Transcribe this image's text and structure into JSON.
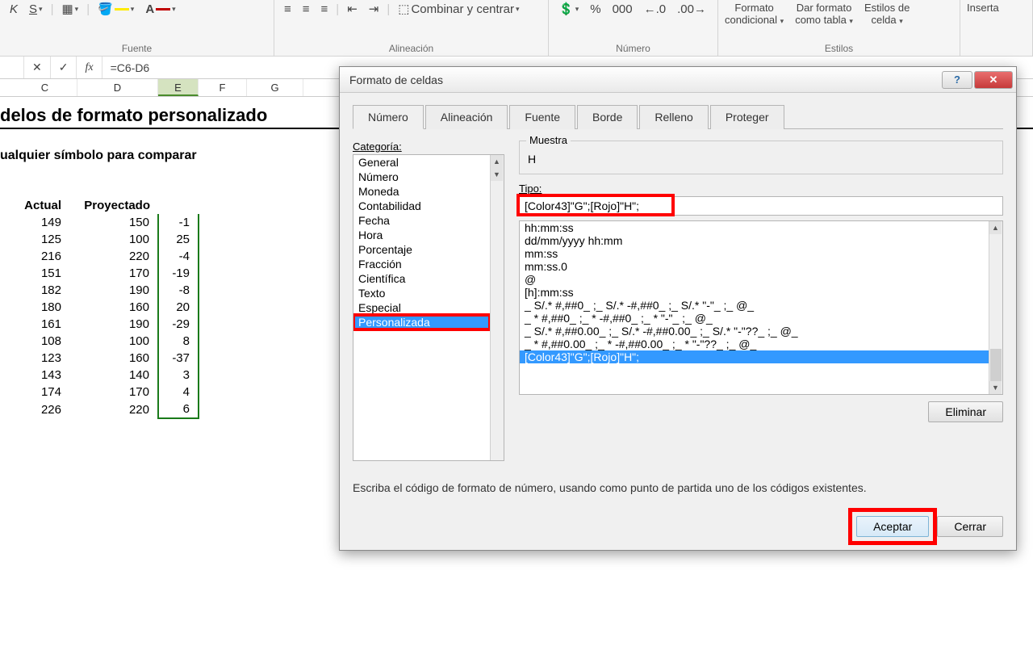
{
  "ribbon": {
    "groups": {
      "fuente": "Fuente",
      "alineacion": "Alineación",
      "numero": "Número",
      "estilos": "Estilos"
    },
    "combinar": "Combinar y centrar",
    "formato_label": "Formato",
    "condicional": "condicional",
    "dar_formato": "Dar formato",
    "como_tabla": "como tabla",
    "estilos_de": "Estilos de",
    "celda": "celda",
    "insertar": "Inserta",
    "simbolos": {
      "K": "K",
      "S": "S",
      "percent": "%",
      "mil": "000",
      "plus": ".0",
      "minus": ".00"
    }
  },
  "formula_bar": {
    "cancel": "✕",
    "enter": "✓",
    "fx": "fx",
    "value": "=C6-D6"
  },
  "columns": [
    "C",
    "D",
    "E",
    "F",
    "G"
  ],
  "sheet": {
    "title": "delos de formato personalizado",
    "subtitle": "ualquier símbolo para comparar",
    "headers": {
      "actual": "Actual",
      "proyectado": "Proyectado"
    },
    "rows": [
      {
        "a": 149,
        "p": 150,
        "d": -1
      },
      {
        "a": 125,
        "p": 100,
        "d": 25
      },
      {
        "a": 216,
        "p": 220,
        "d": -4
      },
      {
        "a": 151,
        "p": 170,
        "d": -19
      },
      {
        "a": 182,
        "p": 190,
        "d": -8
      },
      {
        "a": 180,
        "p": 160,
        "d": 20
      },
      {
        "a": 161,
        "p": 190,
        "d": -29
      },
      {
        "a": 108,
        "p": 100,
        "d": 8
      },
      {
        "a": 123,
        "p": 160,
        "d": -37
      },
      {
        "a": 143,
        "p": 140,
        "d": 3
      },
      {
        "a": 174,
        "p": 170,
        "d": 4
      },
      {
        "a": 226,
        "p": 220,
        "d": 6
      }
    ]
  },
  "dialog": {
    "title": "Formato de celdas",
    "help": "?",
    "close": "✕",
    "tabs": [
      "Número",
      "Alineación",
      "Fuente",
      "Borde",
      "Relleno",
      "Proteger"
    ],
    "cat_label": "Categoría:",
    "categories": [
      "General",
      "Número",
      "Moneda",
      "Contabilidad",
      "Fecha",
      "Hora",
      "Porcentaje",
      "Fracción",
      "Científica",
      "Texto",
      "Especial",
      "Personalizada"
    ],
    "selected_category_index": 11,
    "muestra_label": "Muestra",
    "muestra_value": "H",
    "tipo_label": "Tipo:",
    "tipo_value": "[Color43]\"G\";[Rojo]\"H\";",
    "type_list": [
      "hh:mm:ss",
      "dd/mm/yyyy hh:mm",
      "mm:ss",
      "mm:ss.0",
      "@",
      "[h]:mm:ss",
      "_ S/.* #,##0_ ;_ S/.* -#,##0_ ;_ S/.* \"-\"_ ;_ @_",
      "_ * #,##0_ ;_ * -#,##0_ ;_ * \"-\"_ ;_ @_",
      "_ S/.* #,##0.00_ ;_ S/.* -#,##0.00_ ;_ S/.* \"-\"??_ ;_ @_",
      "_ * #,##0.00_ ;_ * -#,##0.00_ ;_ * \"-\"??_ ;_ @_",
      "[Color43]\"G\";[Rojo]\"H\";"
    ],
    "selected_type_index": 10,
    "eliminar": "Eliminar",
    "instruction": "Escriba el código de formato de número, usando como punto de partida uno de los códigos existentes.",
    "aceptar": "Aceptar",
    "cerrar": "Cerrar"
  }
}
